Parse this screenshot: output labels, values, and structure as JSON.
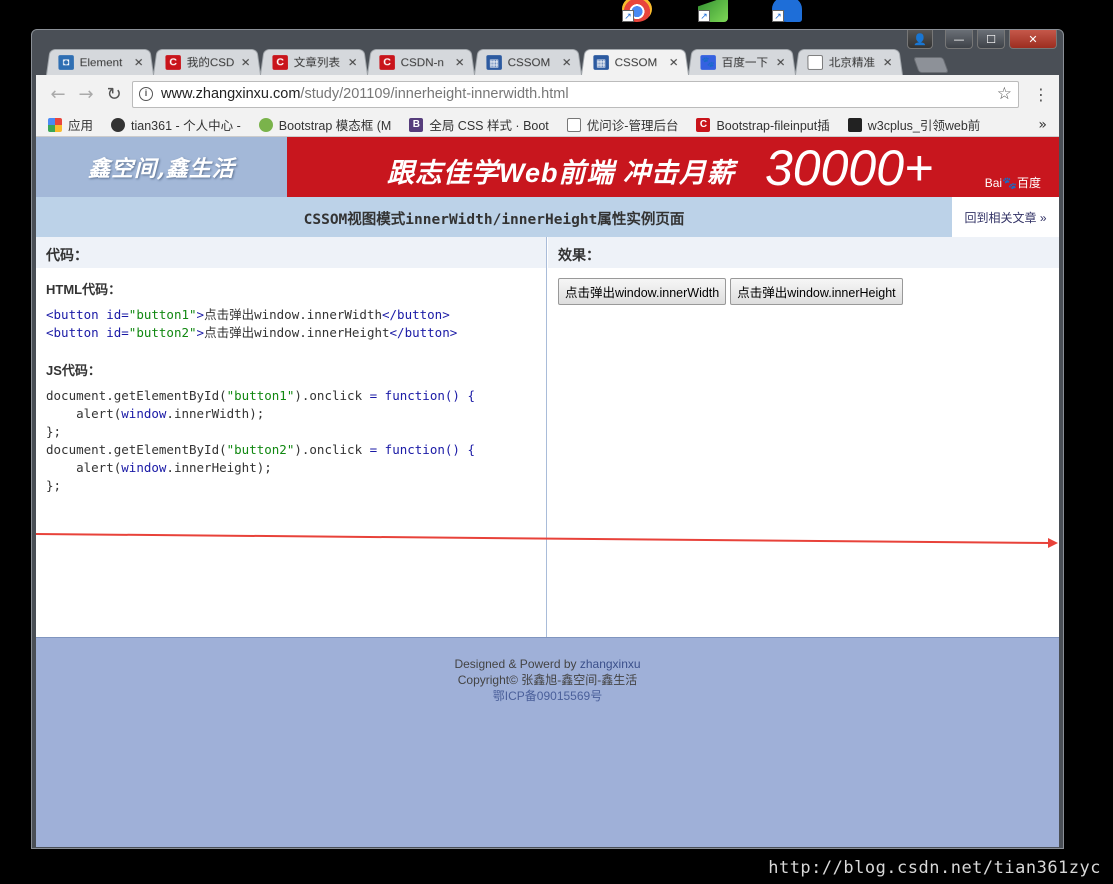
{
  "tabs": [
    {
      "label": "Element",
      "icon": "element-icon",
      "close": "✕"
    },
    {
      "label": "我的CSD",
      "icon": "csdn-icon",
      "close": "✕"
    },
    {
      "label": "文章列表",
      "icon": "csdn-icon",
      "close": "✕"
    },
    {
      "label": "CSDN-n",
      "icon": "csdn-icon",
      "close": "✕"
    },
    {
      "label": "CSSOM",
      "icon": "css-icon",
      "close": "✕"
    },
    {
      "label": "CSSOM",
      "icon": "css-icon",
      "close": "✕",
      "active": true
    },
    {
      "label": "百度一下",
      "icon": "baidu-icon",
      "close": "✕"
    },
    {
      "label": "北京精准",
      "icon": "document-icon",
      "close": "✕"
    }
  ],
  "address": {
    "host": "www.zhangxinxu.com",
    "path": "/study/201109/innerheight-innerwidth.html"
  },
  "bookmarks": [
    {
      "label": "应用",
      "icon": "apps-icon"
    },
    {
      "label": "tian361 - 个人中心 -",
      "icon": "user-icon"
    },
    {
      "label": "Bootstrap 模态框 (M",
      "icon": "bootstrap-icon"
    },
    {
      "label": "全局 CSS 样式 · Boot",
      "icon": "b-icon"
    },
    {
      "label": "优问诊-管理后台",
      "icon": "document-icon"
    },
    {
      "label": "Bootstrap-fileinput插",
      "icon": "csdn-icon"
    },
    {
      "label": "w3cplus_引领web前",
      "icon": "w3cplus-icon"
    }
  ],
  "bookmarks_more": "»",
  "site": {
    "logo": "鑫空间,鑫生活",
    "ad_text": "跟志佳学Web前端  冲击月薪",
    "ad_number": "30000+",
    "ad_brand": "Bai🐾百度",
    "title": "CSSOM视图模式innerWidth/innerHeight属性实例页面",
    "back_link": "回到相关文章 »"
  },
  "code_panel": {
    "heading": "代码：",
    "html_title": "HTML代码：",
    "js_title": "JS代码："
  },
  "html_code": [
    {
      "open": "<button ",
      "attr": "id=",
      "val": "\"button1\"",
      "close": ">",
      "text": "点击弹出window.innerWidth",
      "end": "</button>"
    },
    {
      "open": "<button ",
      "attr": "id=",
      "val": "\"button2\"",
      "close": ">",
      "text": "点击弹出window.innerHeight",
      "end": "</button>"
    }
  ],
  "js_code": [
    {
      "a": "document.getElementById(",
      "s": "\"button1\"",
      "b": ").onclick ",
      "k": "= function() {"
    },
    {
      "a": "    alert(",
      "s": "window",
      "b": ".innerWidth);",
      "k": ""
    },
    {
      "a": "};",
      "s": "",
      "b": "",
      "k": ""
    },
    {
      "a": "document.getElementById(",
      "s": "\"button2\"",
      "b": ").onclick ",
      "k": "= function() {"
    },
    {
      "a": "    alert(",
      "s": "window",
      "b": ".innerHeight);",
      "k": ""
    },
    {
      "a": "};",
      "s": "",
      "b": "",
      "k": ""
    }
  ],
  "effect_panel": {
    "heading": "效果：",
    "button1": "点击弹出window.innerWidth",
    "button2": "点击弹出window.innerHeight"
  },
  "footer": {
    "designed_prefix": "Designed & Powerd by ",
    "designer": "zhangxinxu",
    "copyright": "Copyright© 张鑫旭-鑫空间-鑫生活",
    "icp": "鄂ICP备09015569号"
  },
  "watermark": "http://blog.csdn.net/tian361zyc",
  "colors": {
    "accent_red": "#c8161e",
    "arrow_red": "#e8423a",
    "title_bar": "#bcd2e8",
    "footer_bg": "#9fb0d8"
  }
}
